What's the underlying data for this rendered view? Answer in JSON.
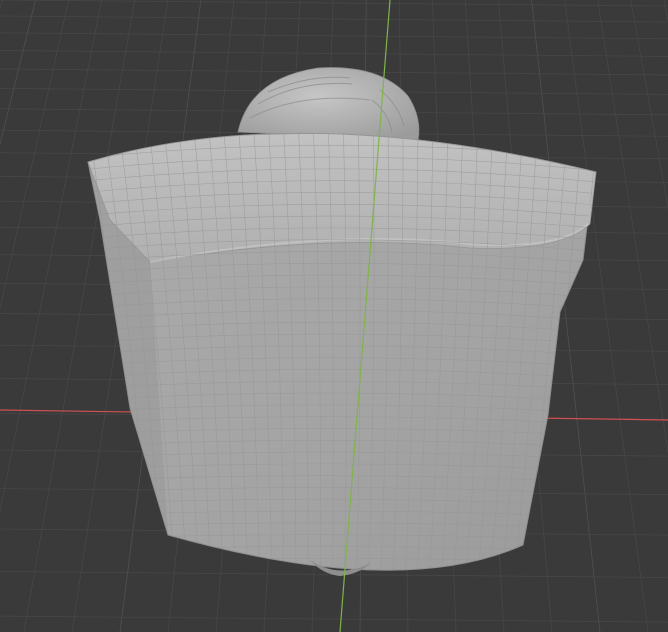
{
  "viewport": {
    "view": "3d-viewport",
    "shading": "solid",
    "overlays": {
      "grid_floor": true,
      "x_axis_line": true,
      "y_axis_line": true
    }
  },
  "scene": {
    "object": "sculpted-mesh",
    "colors": {
      "background": "#3a3a3a",
      "grid_minor": "#474747",
      "grid_major": "#505050",
      "x_axis": "#d05050",
      "y_axis": "#7fb44a",
      "mesh_light": "#bdbdbd",
      "mesh_mid": "#a9a9a9",
      "mesh_shadow": "#8f8f8f",
      "wireframe": "#9b9b9b"
    }
  }
}
